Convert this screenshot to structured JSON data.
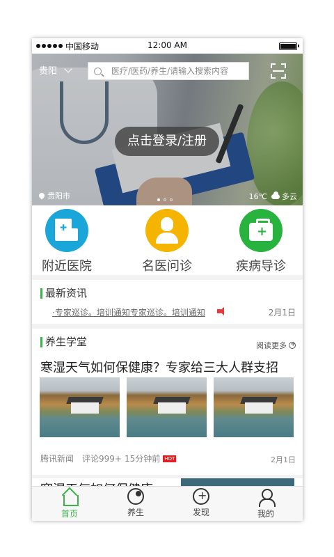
{
  "status_bar": {
    "carrier": "中国移动",
    "time": "12:00 AM"
  },
  "header": {
    "city": "贵阳",
    "search_placeholder": "医疗/医药/养生/请输入搜索内容"
  },
  "banner": {
    "login_label": "点击登录/注册",
    "location": "贵阳市",
    "temperature": "16℃",
    "weather": "多云",
    "pages": 3,
    "active_page": 1
  },
  "quick_entries": [
    {
      "label": "附近医院",
      "icon": "hospital-icon",
      "color": "#1aa6d9"
    },
    {
      "label": "名医问诊",
      "icon": "doctor-icon",
      "color": "#f5b400"
    },
    {
      "label": "疾病导诊",
      "icon": "medical-kit-icon",
      "color": "#28b23e"
    }
  ],
  "news": {
    "title": "最新资讯",
    "ticker": "·专家巡诊。培训通知专家巡诊。培训通知",
    "date": "2月1日"
  },
  "health": {
    "title": "养生学堂",
    "more": "阅读更多",
    "headline": "寒湿天气如何保健康？专家给三大人群支招",
    "source": "腾讯新闻",
    "comments": "评论999+",
    "time_ago": "15分钟前",
    "badge": "HOT",
    "date": "2月1日"
  },
  "next_card": {
    "title": "寒湿天气如何保健康"
  },
  "tabs": [
    {
      "label": "首页",
      "icon": "home-icon",
      "active": true
    },
    {
      "label": "养生",
      "icon": "wellness-icon"
    },
    {
      "label": "发现",
      "icon": "discover-icon"
    },
    {
      "label": "我的",
      "icon": "profile-icon"
    }
  ],
  "colors": {
    "accent": "#3bb34a"
  }
}
